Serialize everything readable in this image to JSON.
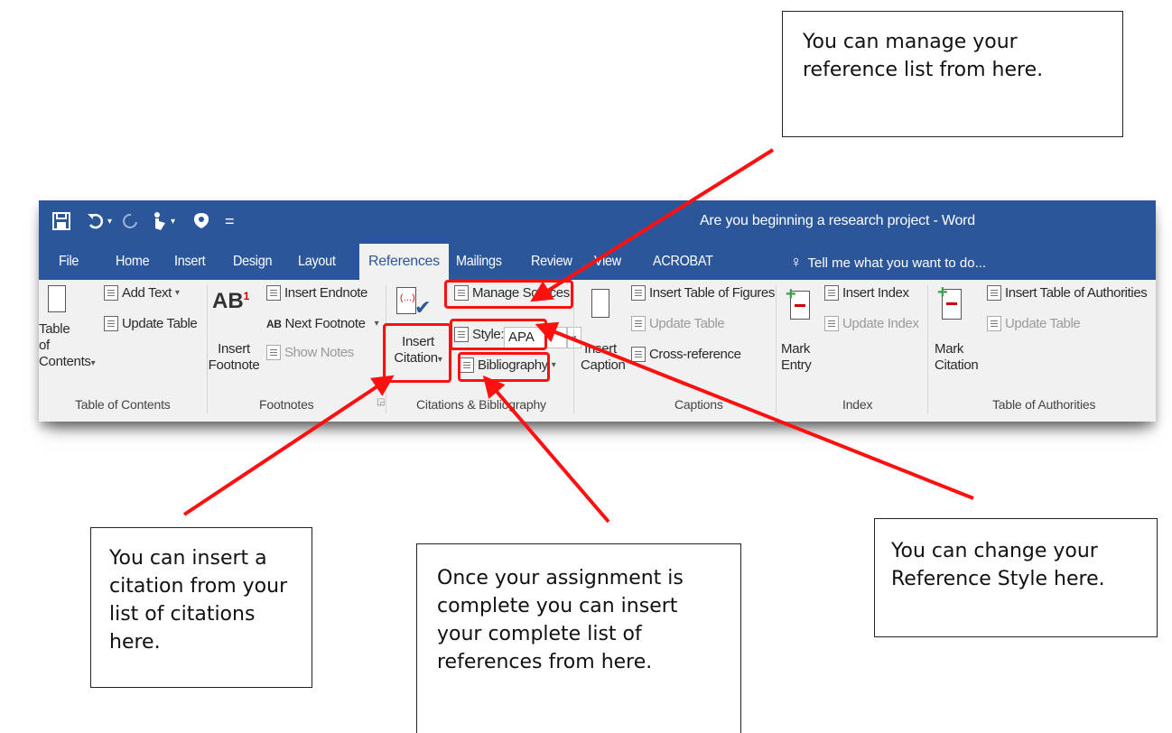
{
  "callouts": {
    "manage_sources": "You can manage your reference list from here.",
    "insert_citation": "You can insert a citation from your list of citations here.",
    "bibliography": "Once your assignment is complete you can insert your complete list of references from here.",
    "style": "You can change your Reference Style here."
  },
  "window": {
    "title": "Are you beginning a research project - Word",
    "title_bar_color": "#2b579a",
    "qat_icons": [
      "save-icon",
      "undo-icon",
      "redo-icon",
      "touch-mode-icon",
      "customize-icon"
    ]
  },
  "tabs": [
    "File",
    "Home",
    "Insert",
    "Design",
    "Layout",
    "References",
    "Mailings",
    "Review",
    "View",
    "ACROBAT"
  ],
  "active_tab": "References",
  "tell_me": "Tell me what you want to do...",
  "ribbon": {
    "toc": {
      "big_button": [
        "Table of",
        "Contents"
      ],
      "add_text": "Add Text",
      "update_table": "Update Table",
      "group_label": "Table of Contents"
    },
    "footnotes": {
      "big_button": [
        "Insert",
        "Footnote"
      ],
      "insert_endnote": "Insert Endnote",
      "next_footnote": "Next Footnote",
      "show_notes": "Show Notes",
      "group_label": "Footnotes"
    },
    "citations": {
      "big_button": [
        "Insert",
        "Citation"
      ],
      "manage_sources": "Manage Sources",
      "style_label": "Style:",
      "style_value": "APA",
      "bibliography": "Bibliography",
      "group_label": "Citations & Bibliography"
    },
    "captions": {
      "big_button": [
        "Insert",
        "Caption"
      ],
      "insert_table_of_figures": "Insert Table of Figures",
      "update_table": "Update Table",
      "cross_reference": "Cross-reference",
      "group_label": "Captions"
    },
    "index": {
      "big_button": [
        "Mark",
        "Entry"
      ],
      "insert_index": "Insert Index",
      "update_index": "Update Index",
      "group_label": "Index"
    },
    "authorities": {
      "big_button": [
        "Mark",
        "Citation"
      ],
      "insert_toa": "Insert Table of Authorities",
      "update_table": "Update Table",
      "group_label": "Table of Authorities"
    }
  },
  "annotation_color": "#ff1010"
}
